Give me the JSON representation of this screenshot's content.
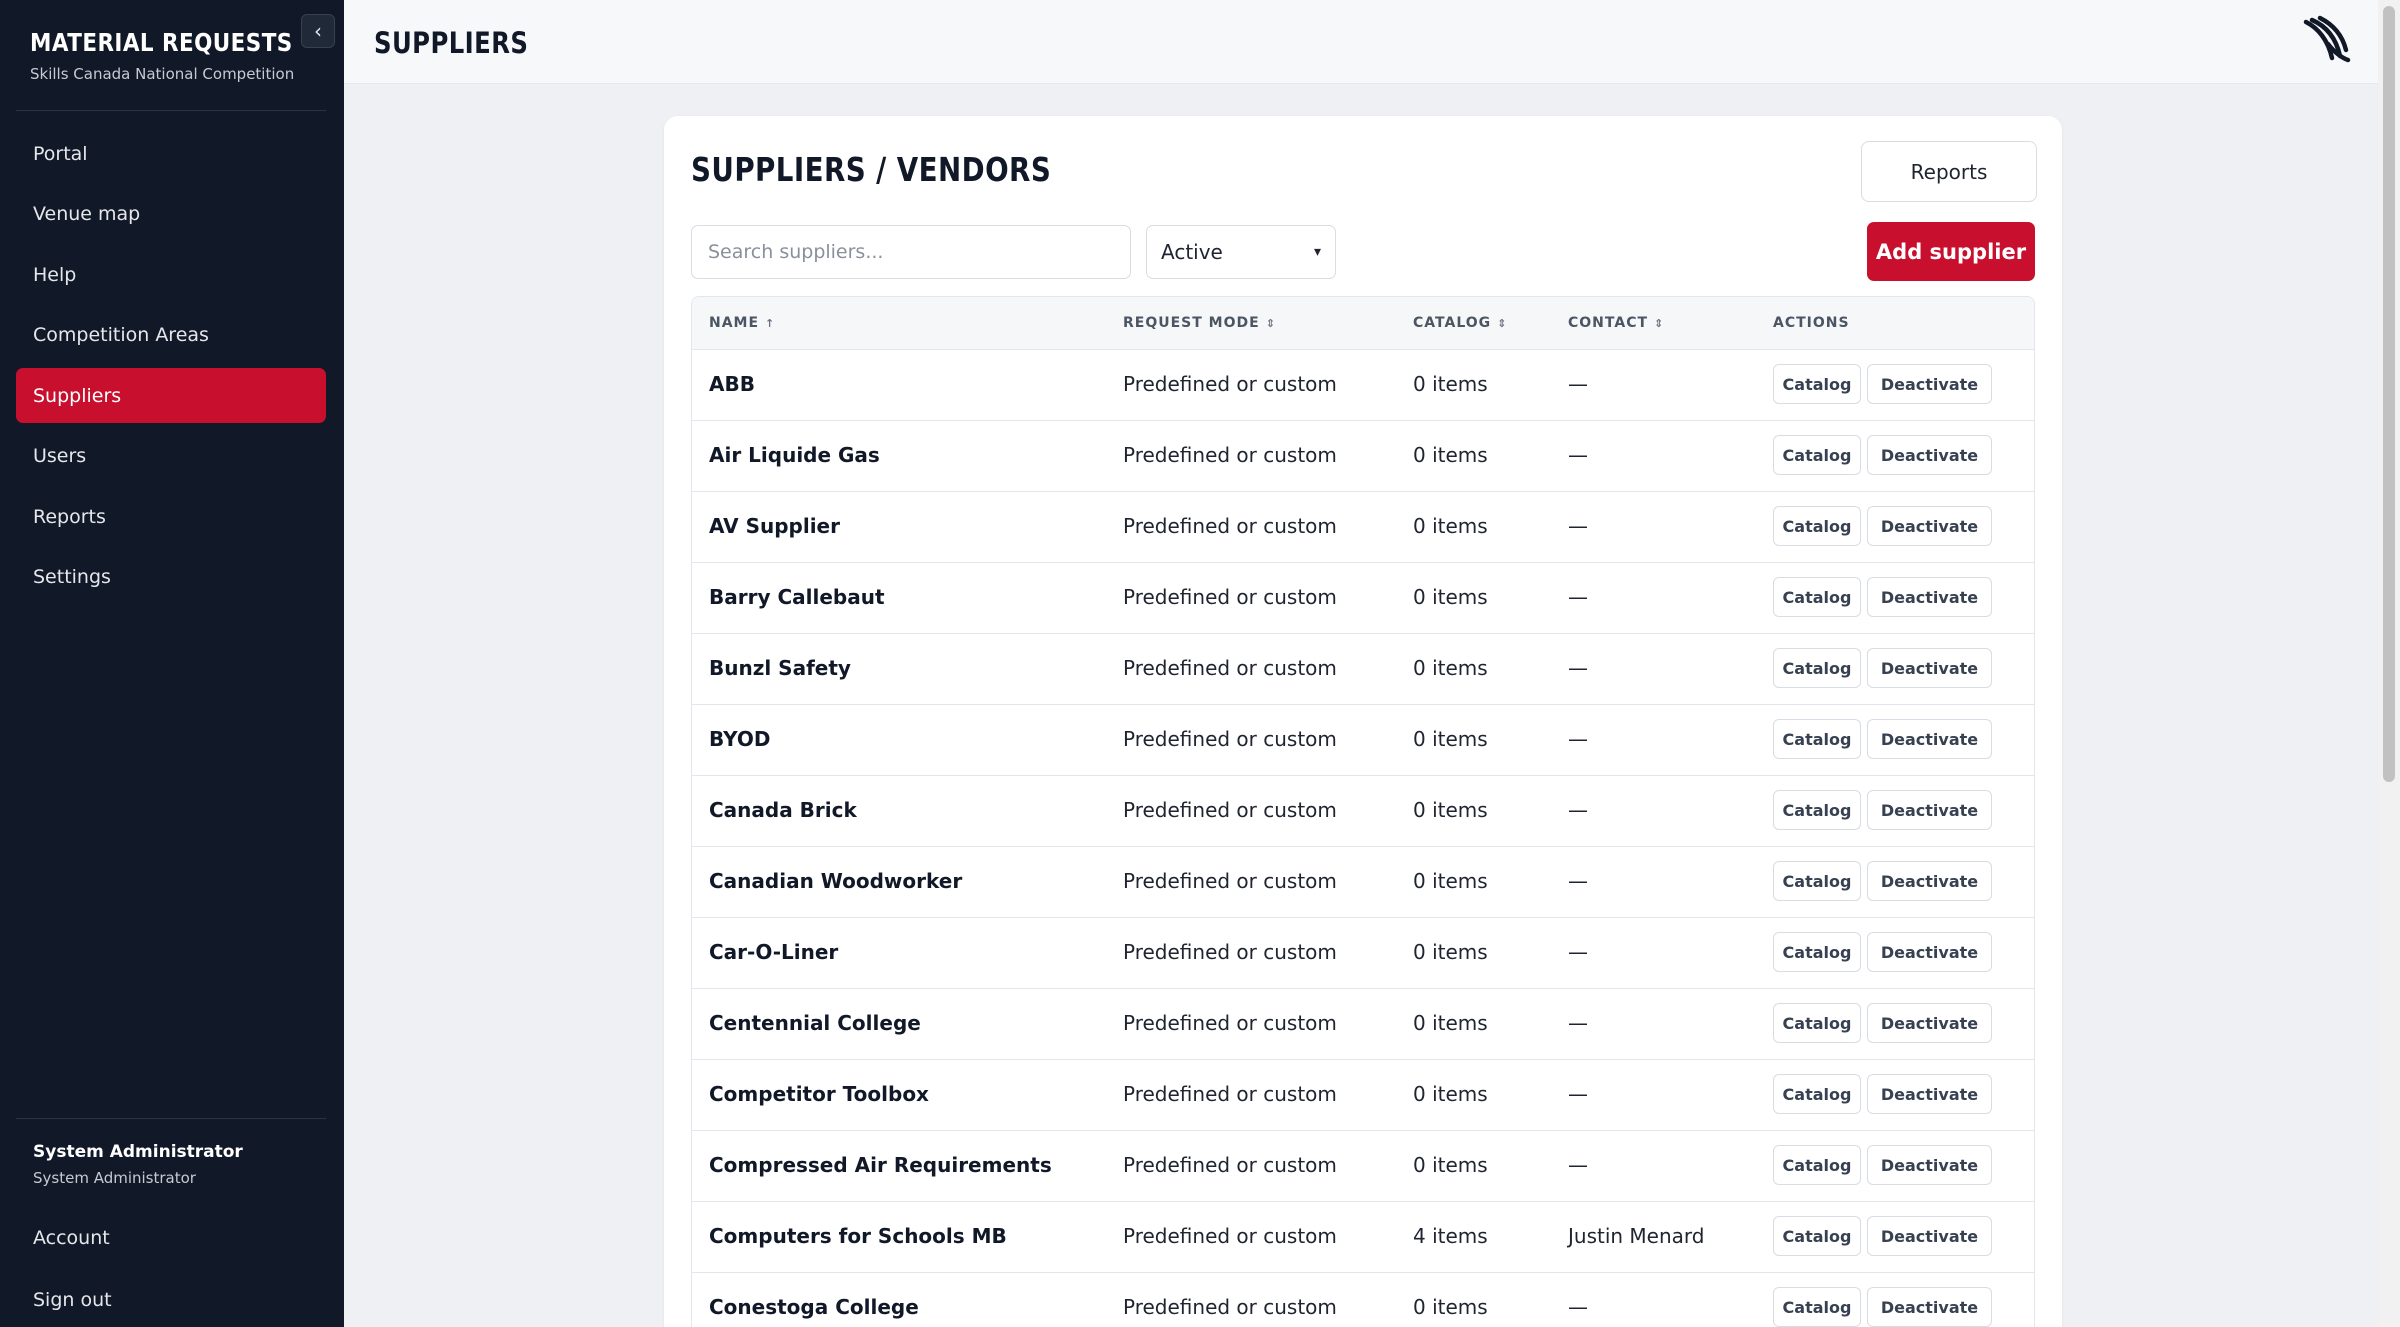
{
  "app": {
    "title": "MATERIAL REQUESTS",
    "subtitle": "Skills Canada National Competition"
  },
  "sidebar": {
    "items": [
      {
        "label": "Portal"
      },
      {
        "label": "Venue map"
      },
      {
        "label": "Help"
      },
      {
        "label": "Competition Areas"
      },
      {
        "label": "Suppliers",
        "active": true
      },
      {
        "label": "Users"
      },
      {
        "label": "Reports"
      },
      {
        "label": "Settings"
      }
    ],
    "user": {
      "name": "System Administrator",
      "role": "System Administrator"
    },
    "account_label": "Account",
    "signout_label": "Sign out"
  },
  "header": {
    "title": "SUPPLIERS"
  },
  "card": {
    "title": "SUPPLIERS / VENDORS",
    "reports_label": "Reports",
    "search_placeholder": "Search suppliers...",
    "filter_value": "Active",
    "add_label": "Add supplier"
  },
  "table": {
    "columns": {
      "name": "NAME",
      "mode": "REQUEST MODE",
      "catalog": "CATALOG",
      "contact": "CONTACT",
      "actions": "ACTIONS"
    },
    "catalog_btn": "Catalog",
    "deactivate_btn": "Deactivate",
    "rows": [
      {
        "name": "ABB",
        "mode": "Predefined or custom",
        "catalog": "0 items",
        "contact": "—"
      },
      {
        "name": "Air Liquide Gas",
        "mode": "Predefined or custom",
        "catalog": "0 items",
        "contact": "—"
      },
      {
        "name": "AV Supplier",
        "mode": "Predefined or custom",
        "catalog": "0 items",
        "contact": "—"
      },
      {
        "name": "Barry Callebaut",
        "mode": "Predefined or custom",
        "catalog": "0 items",
        "contact": "—"
      },
      {
        "name": "Bunzl Safety",
        "mode": "Predefined or custom",
        "catalog": "0 items",
        "contact": "—"
      },
      {
        "name": "BYOD",
        "mode": "Predefined or custom",
        "catalog": "0 items",
        "contact": "—"
      },
      {
        "name": "Canada Brick",
        "mode": "Predefined or custom",
        "catalog": "0 items",
        "contact": "—"
      },
      {
        "name": "Canadian Woodworker",
        "mode": "Predefined or custom",
        "catalog": "0 items",
        "contact": "—"
      },
      {
        "name": "Car-O-Liner",
        "mode": "Predefined or custom",
        "catalog": "0 items",
        "contact": "—"
      },
      {
        "name": "Centennial College",
        "mode": "Predefined or custom",
        "catalog": "0 items",
        "contact": "—"
      },
      {
        "name": "Competitor Toolbox",
        "mode": "Predefined or custom",
        "catalog": "0 items",
        "contact": "—"
      },
      {
        "name": "Compressed Air Requirements",
        "mode": "Predefined or custom",
        "catalog": "0 items",
        "contact": "—"
      },
      {
        "name": "Computers for Schools MB",
        "mode": "Predefined or custom",
        "catalog": "4 items",
        "contact": "Justin Menard"
      },
      {
        "name": "Conestoga College",
        "mode": "Predefined or custom",
        "catalog": "0 items",
        "contact": "—"
      }
    ]
  },
  "colors": {
    "accent": "#c8102e",
    "sidebar_bg": "#111827"
  }
}
